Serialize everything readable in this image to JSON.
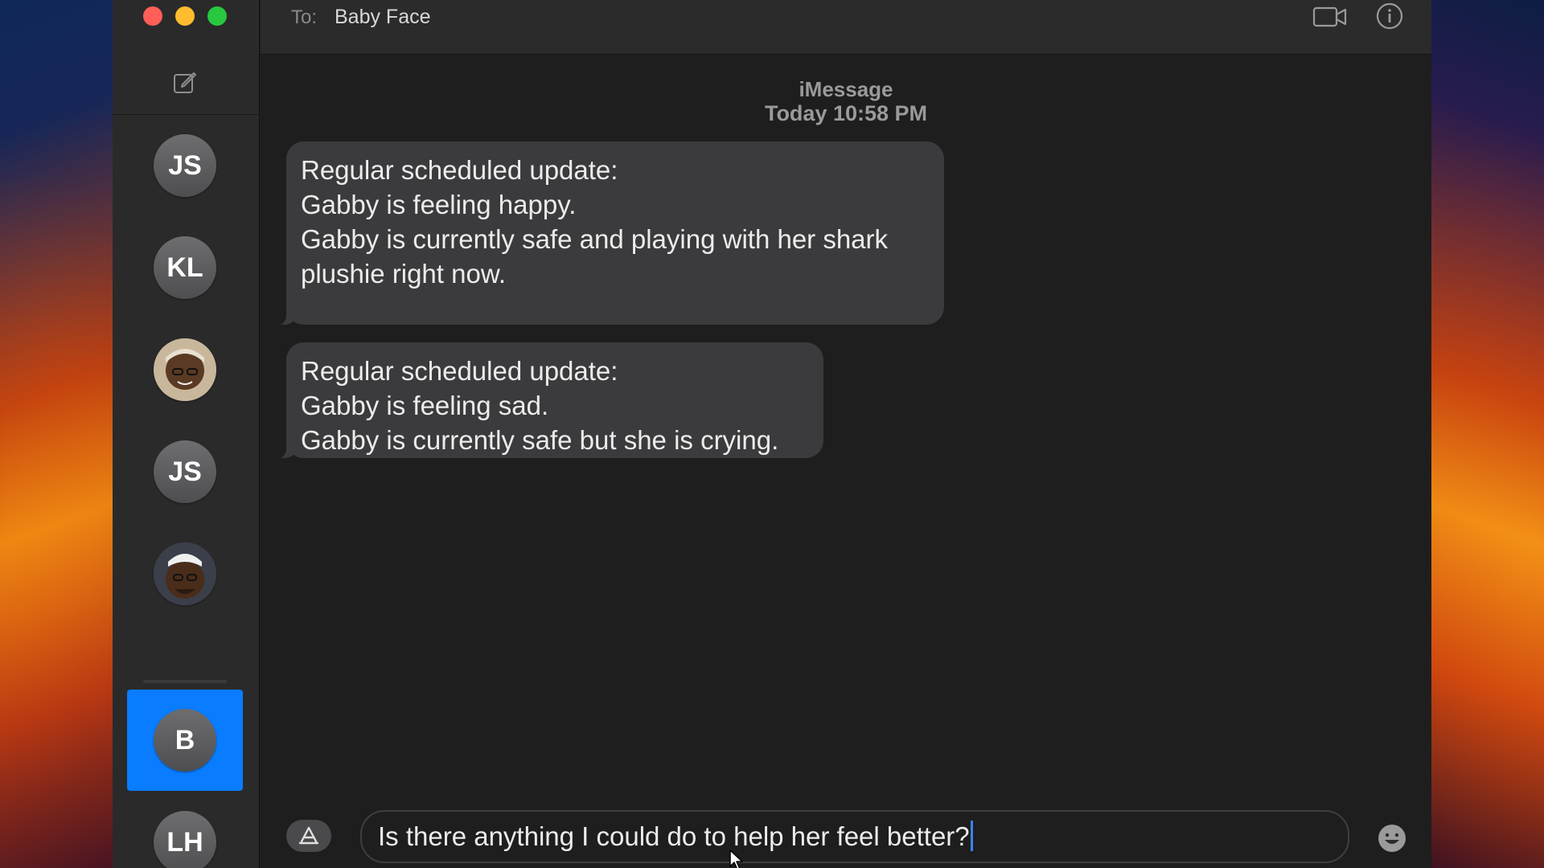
{
  "window": {
    "controls": [
      "close",
      "minimize",
      "zoom"
    ]
  },
  "sidebar": {
    "compose_icon": "compose-icon",
    "conversations": [
      {
        "initials": "JS",
        "type": "initials",
        "selected": false
      },
      {
        "initials": "KL",
        "type": "initials",
        "selected": false
      },
      {
        "initials": "",
        "type": "photo",
        "selected": false
      },
      {
        "initials": "JS",
        "type": "initials",
        "selected": false
      },
      {
        "initials": "",
        "type": "photo",
        "selected": false
      },
      {
        "initials": "B",
        "type": "initials",
        "selected": true
      },
      {
        "initials": "LH",
        "type": "initials",
        "selected": false
      }
    ]
  },
  "header": {
    "to_label": "To:",
    "recipient": "Baby Face",
    "video_icon": "video-camera-icon",
    "info_icon": "info-icon"
  },
  "transcript": {
    "service": "iMessage",
    "timestamp": "Today 10:58 PM",
    "messages": [
      {
        "direction": "incoming",
        "text": "Regular scheduled update:\nGabby is feeling happy.\nGabby is currently safe and playing with her shark\nplushie right now."
      },
      {
        "direction": "incoming",
        "text": "Regular scheduled update:\nGabby is feeling sad.\nGabby is currently safe but she is crying."
      }
    ]
  },
  "composer": {
    "apps_icon": "app-store-icon",
    "value": "Is there anything I could do to help her feel better?",
    "emoji_icon": "emoji-icon"
  },
  "colors": {
    "selected": "#0a7cff",
    "bubble_incoming": "#3b3b3d",
    "caret": "#3b82f6"
  }
}
